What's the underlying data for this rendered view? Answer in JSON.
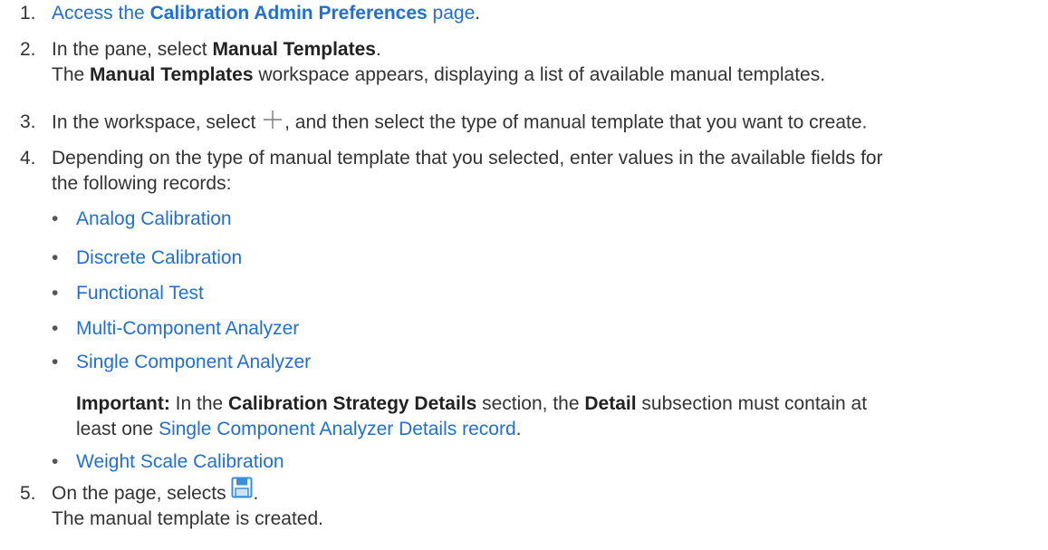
{
  "steps": [
    {
      "number": "1.",
      "link_pre": "Access the ",
      "link_bold": "Calibration Admin Preferences",
      "link_post": " page",
      "end": "."
    },
    {
      "number": "2.",
      "pre": "In the pane, select ",
      "bold": "Manual Templates",
      "post": ".",
      "result_pre": "The ",
      "result_bold": "Manual Templates",
      "result_post": " workspace appears, displaying a list of available manual templates."
    },
    {
      "number": "3.",
      "pre": "In the workspace, select ",
      "icon": "plus-icon",
      "post": ", and then select the type of manual template that you want to create."
    },
    {
      "number": "4.",
      "line1": "Depending on the type of manual template that you selected, enter values in the available fields for",
      "line2": "the following records:"
    },
    {
      "number": "5.",
      "pre": "On the page, selects ",
      "icon": "save-icon",
      "post": ".",
      "result": "The manual template is created."
    }
  ],
  "records": [
    {
      "label": "Analog Calibration"
    },
    {
      "label": "Discrete Calibration"
    },
    {
      "label": "Functional Test"
    },
    {
      "label": "Multi-Component Analyzer"
    },
    {
      "label": "Single Component Analyzer"
    },
    {
      "label": "Weight Scale Calibration"
    }
  ],
  "bullet_char": "•",
  "note": {
    "label": "Important:",
    "t1": " In the ",
    "b1": "Calibration Strategy Details",
    "t2": " section, the ",
    "b2": "Detail",
    "t3": " subsection must contain at",
    "t4": "least one ",
    "link": "Single Component Analyzer Details record",
    "t5": "."
  },
  "colors": {
    "link": "#1f6fd6",
    "text": "#333333",
    "save_icon": "#3a8fd8"
  }
}
